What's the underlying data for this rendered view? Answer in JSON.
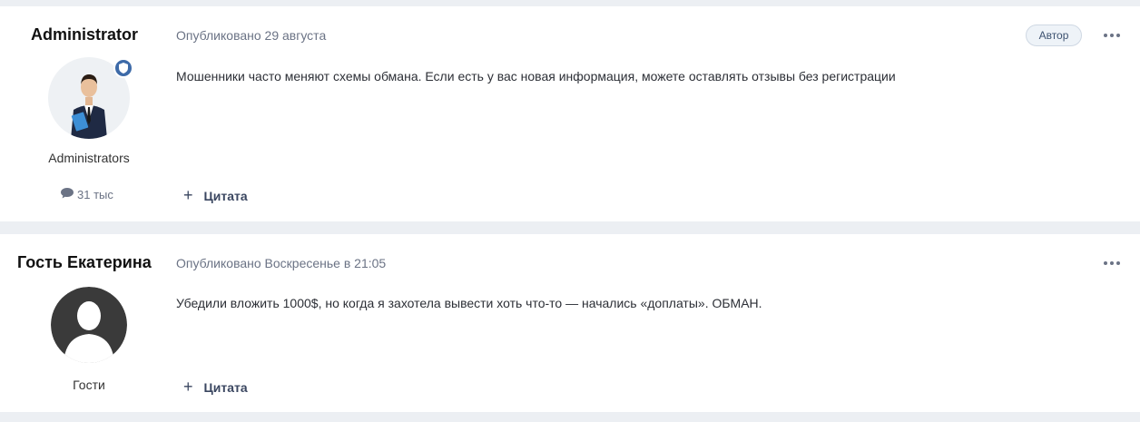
{
  "posts": [
    {
      "author": "Administrator",
      "group": "Administrators",
      "posts_count": "31 тыс",
      "published": "Опубликовано 29 августа",
      "badge": "Автор",
      "content": "Мошенники часто меняют схемы обмана. Если есть у вас новая информация, можете оставлять отзывы без регистрации",
      "quote_label": "Цитата"
    },
    {
      "author": "Гость Екатерина",
      "group": "Гости",
      "published": "Опубликовано Воскресенье в 21:05",
      "content": "Убедили вложить 1000$, но когда я захотела вывести хоть что-то — начались «доплаты». ОБМАН.",
      "quote_label": "Цитата"
    }
  ],
  "icons": {
    "more": "more-horizontal-icon",
    "comment": "comment-icon",
    "shield": "shield-icon",
    "plus": "plus-icon"
  },
  "colors": {
    "badge_bg": "#eef3f8",
    "meta_text": "#6b7385",
    "shield_bg": "#3d6aa8"
  }
}
